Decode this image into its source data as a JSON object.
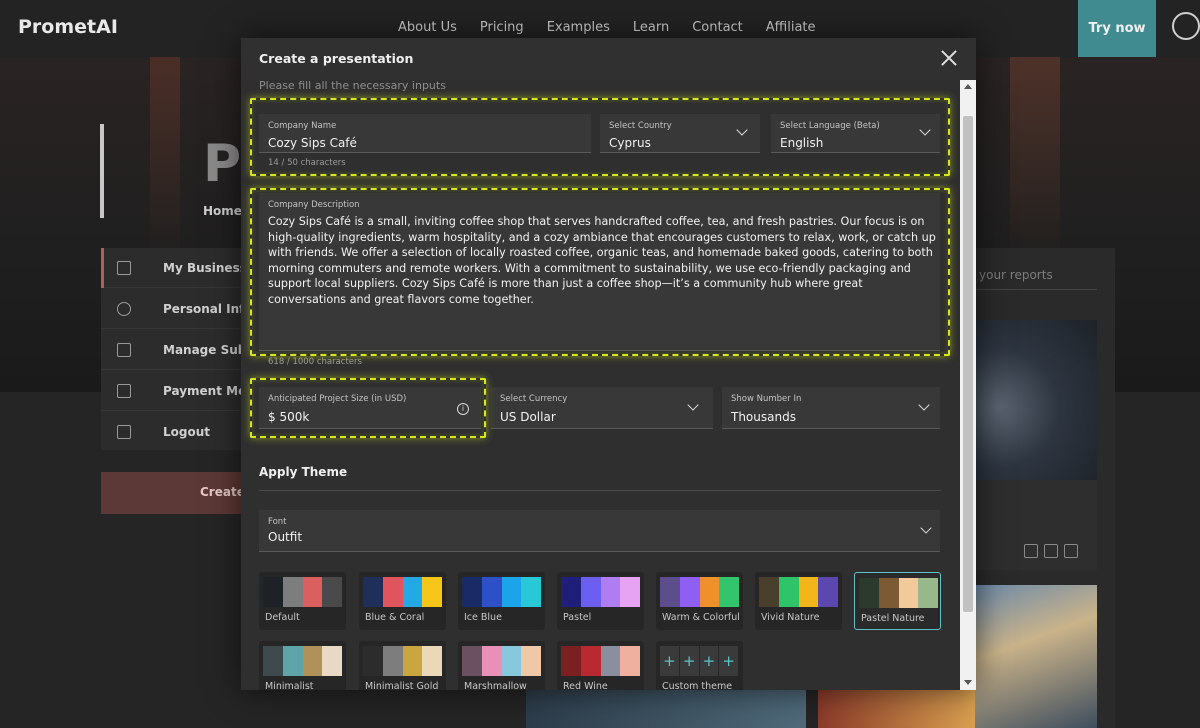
{
  "nav": {
    "logo": "PrometAI",
    "links": [
      "About Us",
      "Pricing",
      "Examples",
      "Learn",
      "Contact",
      "Affiliate"
    ],
    "try_now": "Try now"
  },
  "background": {
    "big_title": "Pe",
    "breadcrumb": "Home",
    "menu": [
      {
        "label": "My Business P",
        "icon": "briefcase-icon"
      },
      {
        "label": "Personal Infor",
        "icon": "user-icon"
      },
      {
        "label": "Manage Subsc",
        "icon": "card-icon"
      },
      {
        "label": "Payment Meth",
        "icon": "list-icon"
      },
      {
        "label": "Logout",
        "icon": "logout-icon"
      }
    ],
    "create_label": "Create",
    "search_placeholder": "your reports"
  },
  "modal": {
    "title": "Create a presentation",
    "subtitle": "Please fill all the necessary inputs",
    "company_name": {
      "label": "Company Name",
      "value": "Cozy Sips Café",
      "counter": "14 / 50 characters"
    },
    "country": {
      "label": "Select Country",
      "value": "Cyprus"
    },
    "language": {
      "label": "Select Language (Beta)",
      "value": "English"
    },
    "description": {
      "label": "Company Description",
      "value": "Cozy Sips Café is a small, inviting coffee shop that serves handcrafted coffee, tea, and fresh pastries. Our focus is on high-quality ingredients, warm hospitality, and a cozy ambiance that encourages customers to relax, work, or catch up with friends. We offer a selection of locally roasted coffee, organic teas, and homemade baked goods, catering to both morning commuters and remote workers. With a commitment to sustainability, we use eco-friendly packaging and support local suppliers. Cozy Sips Café is more than just a coffee shop—it’s a community hub where great conversations and great flavors come together.",
      "counter": "618 / 1000 characters"
    },
    "project_size": {
      "label": "Anticipated Project Size (in USD)",
      "value": "$ 500k"
    },
    "currency": {
      "label": "Select Currency",
      "value": "US Dollar"
    },
    "show_number": {
      "label": "Show Number In",
      "value": "Thousands"
    },
    "apply_theme": "Apply Theme",
    "font": {
      "label": "Font",
      "value": "Outfit"
    },
    "themes": [
      {
        "name": "Default",
        "colors": [
          "#1e2226",
          "#7d7d7d",
          "#d9605e",
          "#4a4a4a"
        ]
      },
      {
        "name": "Blue & Coral",
        "colors": [
          "#1f2f5a",
          "#e0545e",
          "#23a9e6",
          "#f7c61a"
        ]
      },
      {
        "name": "Ice Blue",
        "colors": [
          "#1a2a66",
          "#2d4fc7",
          "#1ba4e8",
          "#29c8d6"
        ]
      },
      {
        "name": "Pastel",
        "colors": [
          "#1f1f7a",
          "#6b5ef0",
          "#b07cf2",
          "#e6a3f3"
        ]
      },
      {
        "name": "Warm & Colorful",
        "colors": [
          "#5b4e8a",
          "#8f5ef2",
          "#f0902a",
          "#35c46e"
        ]
      },
      {
        "name": "Vivid Nature",
        "colors": [
          "#4a3f2c",
          "#2ec46a",
          "#f2b61b",
          "#5c46b0"
        ]
      },
      {
        "name": "Pastel Nature",
        "colors": [
          "#2c3a2e",
          "#7b5a34",
          "#f2c99a",
          "#96b88a"
        ]
      },
      {
        "name": "Minimalist",
        "colors": [
          "#3f4a4e",
          "#5ea4a8",
          "#b0915a",
          "#e8d9c4"
        ]
      },
      {
        "name": "Minimalist Gold",
        "colors": [
          "#2c2c2c",
          "#7d7d7d",
          "#c9a640",
          "#ead8b8"
        ]
      },
      {
        "name": "Marshmallow",
        "colors": [
          "#6a5060",
          "#e890b8",
          "#88c8dc",
          "#f0c8a8"
        ]
      },
      {
        "name": "Red Wine",
        "colors": [
          "#7a1f22",
          "#b82a30",
          "#8a8fa0",
          "#f0b0a0"
        ]
      }
    ],
    "custom_theme": "Custom theme",
    "selected_theme": "Pastel Nature",
    "accent": "#5fc3c5",
    "highlight_color": "#d6e81c"
  }
}
